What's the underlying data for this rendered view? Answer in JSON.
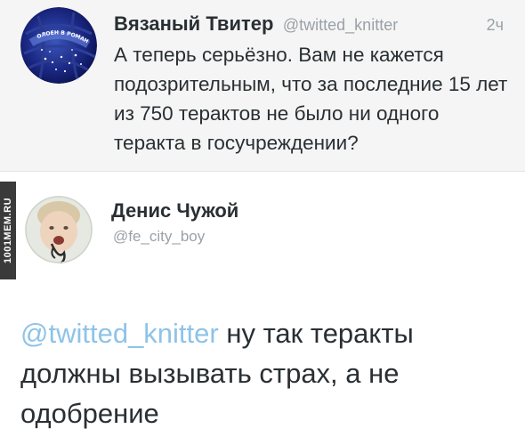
{
  "tweet_original": {
    "author_name": "Вязаный Твитер",
    "author_handle": "@twitted_knitter",
    "time": "2ч",
    "text": "А теперь серьёзно. Вам не кажется подозрительным, что за последние 15 лет из 750 терактов не было ни одного теракта в госучреждении?",
    "avatar_icon": "yarn-ball-avatar-icon",
    "avatar_label": "ОЛОЕН В РОМАНТИКЕ"
  },
  "tweet_reply": {
    "author_name": "Денис Чужой",
    "author_handle": "@fe_city_boy",
    "avatar_icon": "child-photo-avatar-icon",
    "mention": "@twitted_knitter",
    "text": " ну так теракты должны вызывать страх, а не одобрение"
  },
  "watermark": {
    "text": "1001MEM.RU"
  },
  "colors": {
    "top_background": "#f5f5f5",
    "text": "#292f33",
    "muted": "#9aa1a7",
    "mention": "#8ec3e8"
  }
}
